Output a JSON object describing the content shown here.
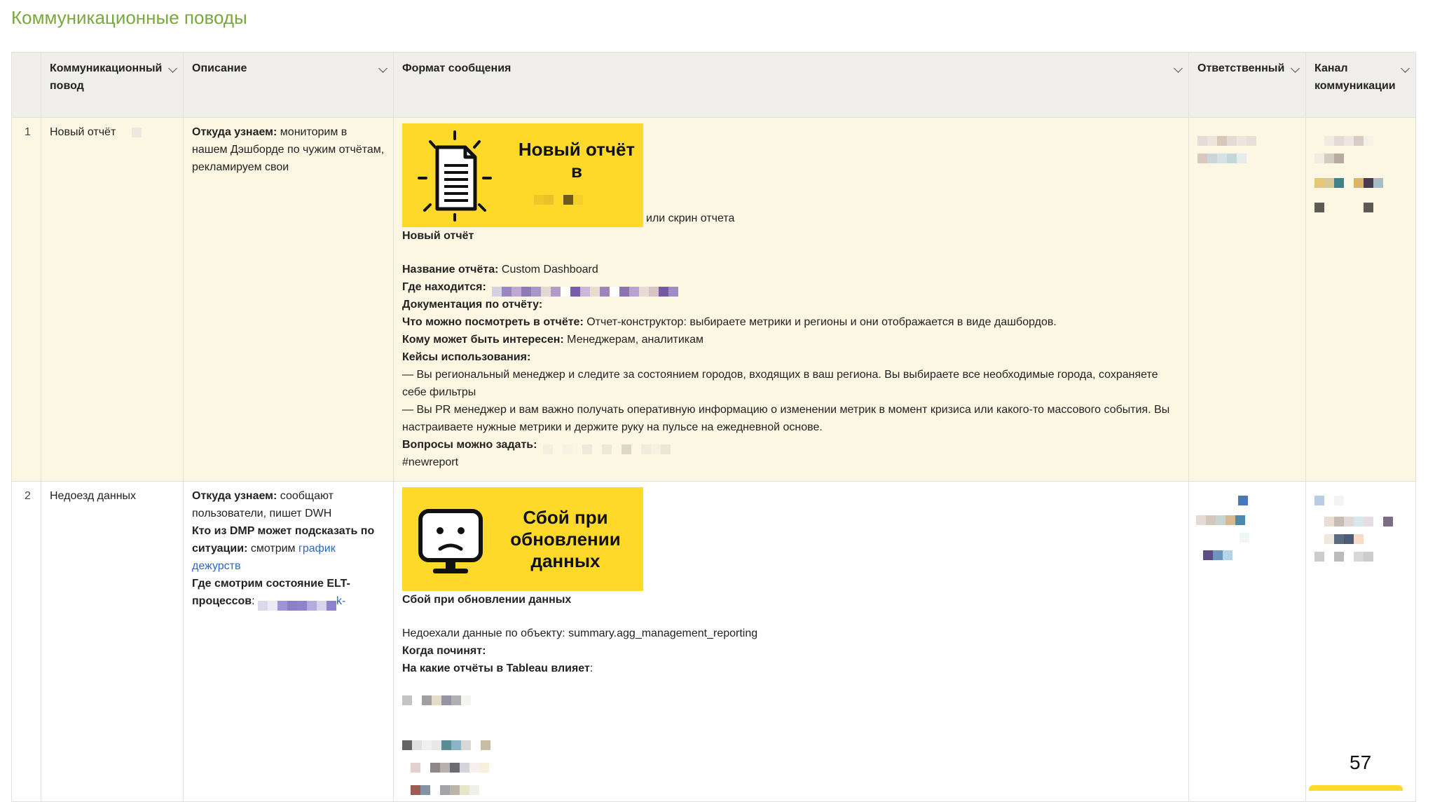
{
  "page": {
    "title": "Коммуникационные поводы",
    "page_number": "57"
  },
  "columns": [
    {
      "label": ""
    },
    {
      "label": "Коммуникационный повод"
    },
    {
      "label": "Описание"
    },
    {
      "label": "Формат сообщения"
    },
    {
      "label": "Ответственный"
    },
    {
      "label": "Канал коммуникации"
    }
  ],
  "rows": [
    {
      "num": "1",
      "occasion": "Новый отчёт",
      "description": {
        "label": "Откуда узнаем:",
        "text": " мониторим в нашем Дэшборде по чужим отчётам, рекламируем свои"
      },
      "message": {
        "banner_text": "Новый отчёт в",
        "banner_icon": "document-icon",
        "after_banner": "или скрин отчета",
        "heading": "Новый отчёт",
        "report_name_label": "Название отчёта:",
        "report_name": " Custom Dashboard",
        "location_label": "Где находится:",
        "docs_label": "Документация по отчёту:",
        "what_label": "Что можно посмотреть в отчёте:",
        "what_text": " Отчет-конструктор: выбираете метрики и регионы и они отображается в виде дашбордов.",
        "who_label": "Кому может быть интересен:",
        "who_text": " Менеджерам, аналитикам",
        "cases_label": "Кейсы использования:",
        "case_1": "— Вы региональный менеджер и следите за состоянием городов, входящих в ваш региона. Вы выбираете все необходимые города, сохраняете себе фильтры",
        "case_2": "— Вы PR менеджер и вам важно получать оперативную информацию о изменении метрик в момент кризиса или какого-то массового события. Вы настраиваете нужные метрики и держите руку на пульсе на ежедневной основе.",
        "questions_label": "Вопросы можно задать:",
        "hashtag": "#newreport"
      }
    },
    {
      "num": "2",
      "occasion": "Недоезд данных",
      "description": {
        "label_1": "Откуда узнаем:",
        "text_1": " сообщают пользователи, пишет DWH",
        "label_2": "Кто из DMP может подсказать по ситуации:",
        "text_2": " смотрим ",
        "link_2": "график дежурств",
        "label_3": "Где смотрим состояние ELT-процессов",
        "text_3": ":",
        "link_3_tail": "k-"
      },
      "message": {
        "banner_text": "Сбой при обновлении данных",
        "banner_icon": "sad-monitor-icon",
        "heading": "Сбой при обновлении данных",
        "object_text": "Недоехали данные по объекту: summary.agg_management_reporting",
        "when_label": "Когда починят:",
        "affects_label": "На какие отчёты в Tableau влияет",
        "affects_colon": ":"
      }
    }
  ],
  "colors": {
    "accent_title": "#7aa83c",
    "banner_yellow": "#fed92a",
    "row1_bg": "#fbf7e2",
    "header_bg": "#efeeea",
    "link": "#2d67c5"
  }
}
